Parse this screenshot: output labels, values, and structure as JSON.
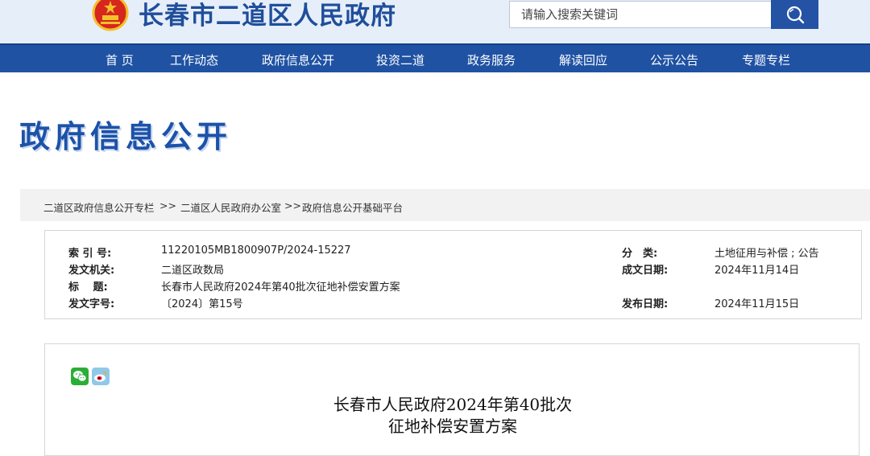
{
  "header": {
    "site_title": "长春市二道区人民政府",
    "search_placeholder": "请输入搜索关键词",
    "brand_color": "#1f52a3"
  },
  "nav": {
    "items": [
      "首 页",
      "工作动态",
      "政府信息公开",
      "投资二道",
      "政务服务",
      "解读回应",
      "公示公告",
      "专题专栏"
    ]
  },
  "banner": {
    "title": "政府信息公开"
  },
  "breadcrumb": {
    "items": [
      "二道区政府信息公开专栏",
      "二道区人民政府办公室",
      "政府信息公开基础平台"
    ],
    "separators": [
      ">>",
      ">>"
    ]
  },
  "info": {
    "index_label": "索 引 号:",
    "index_value": "11220105MB1800907P/2024-15227",
    "issuer_label": "发文机关:",
    "issuer_value": "二道区政数局",
    "title_label": "标　 题:",
    "title_value": "长春市人民政府2024年第40批次征地补偿安置方案",
    "docno_label": "发文字号:",
    "docno_value": "〔2024〕第15号",
    "category_label": "分　类:",
    "category_value": "土地征用与补偿 ; 公告",
    "written_label": "成文日期:",
    "written_value": "2024年11月14日",
    "published_label": "发布日期:",
    "published_value": "2024年11月15日"
  },
  "article": {
    "title_line1": "长春市人民政府2024年第40批次",
    "title_line2": "征地补偿安置方案",
    "share_icons": [
      "wechat-icon",
      "weibo-icon"
    ]
  }
}
